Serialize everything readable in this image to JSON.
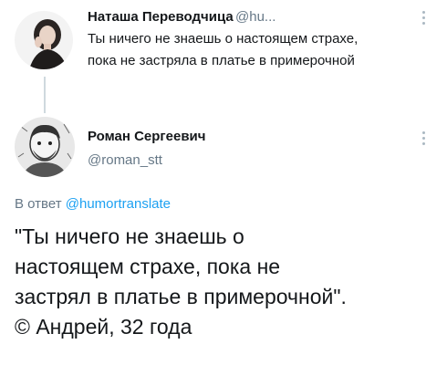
{
  "tweet1": {
    "display_name": "Наташа Переводчица",
    "handle": "@hu...",
    "text_lines": [
      "Ты ничего не знаешь о настоящем страхе,",
      "пока не застряла в платье в примерочной"
    ]
  },
  "tweet2": {
    "display_name": "Роман Сергеевич",
    "handle": "@roman_stt",
    "reply_prefix": "В ответ ",
    "reply_to": "@humortranslate",
    "text_lines": [
      "\"Ты ничего не знаешь о",
      "настоящем страхе, пока не",
      "застрял в платье в примерочной\".",
      "© Андрей, 32 года"
    ]
  },
  "icons": {
    "more": "more-dots-icon"
  },
  "colors": {
    "text": "#14171a",
    "secondary": "#657786",
    "link": "#1da1f2",
    "thread_line": "#cfd9de"
  }
}
